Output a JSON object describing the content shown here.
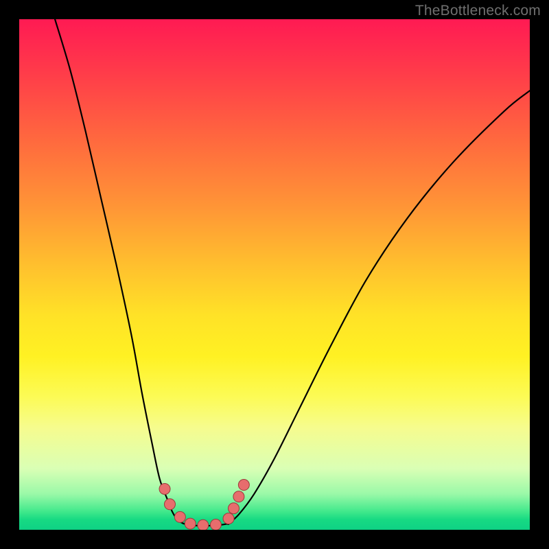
{
  "watermark": "TheBottleneck.com",
  "chart_data": {
    "type": "line",
    "title": "",
    "xlabel": "",
    "ylabel": "",
    "xlim": [
      0,
      100
    ],
    "ylim": [
      0,
      100
    ],
    "series": [
      {
        "name": "left-curve",
        "x": [
          7,
          10,
          13,
          16,
          19,
          22,
          24,
          26,
          27.5,
          29,
          30,
          31,
          32,
          33
        ],
        "y": [
          100,
          90,
          78,
          65,
          52,
          38,
          27,
          17,
          10,
          6,
          3.5,
          2,
          1.3,
          1
        ]
      },
      {
        "name": "valley-floor",
        "x": [
          33,
          35,
          37,
          39,
          41
        ],
        "y": [
          1,
          0.8,
          0.8,
          0.9,
          1.2
        ]
      },
      {
        "name": "right-curve",
        "x": [
          41,
          43,
          46,
          50,
          55,
          61,
          68,
          76,
          85,
          95,
          100
        ],
        "y": [
          1.2,
          3,
          7,
          14,
          24,
          36,
          49,
          61,
          72,
          82,
          86
        ]
      }
    ],
    "markers": [
      {
        "x": 28.5,
        "y": 8
      },
      {
        "x": 29.5,
        "y": 5
      },
      {
        "x": 31.5,
        "y": 2.5
      },
      {
        "x": 33.5,
        "y": 1.2
      },
      {
        "x": 36,
        "y": 0.9
      },
      {
        "x": 38.5,
        "y": 1.0
      },
      {
        "x": 41,
        "y": 2.2
      },
      {
        "x": 42,
        "y": 4.2
      },
      {
        "x": 43,
        "y": 6.5
      },
      {
        "x": 44,
        "y": 8.8
      }
    ],
    "colors": {
      "curve": "#000000",
      "marker": "#e76d6d",
      "marker_stroke": "#9a3b3b",
      "gradient_top": "#ff1a53",
      "gradient_mid": "#ffe227",
      "gradient_bottom": "#0fd184"
    }
  }
}
